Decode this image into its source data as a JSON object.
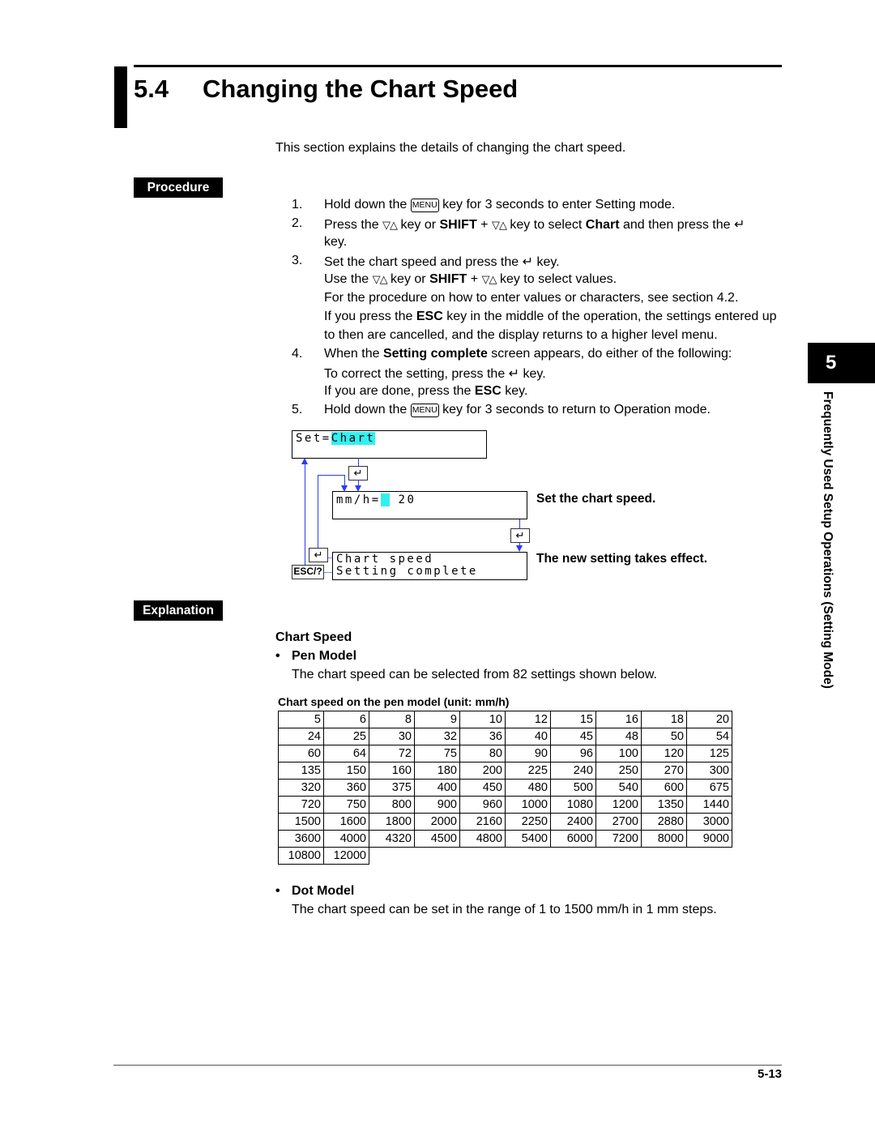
{
  "section": {
    "number": "5.4",
    "title": "Changing the Chart Speed",
    "intro": "This section explains the details of changing the chart speed."
  },
  "procedure_label": "Procedure",
  "explanation_label": "Explanation",
  "keys": {
    "menu": "MENU",
    "updown": "▽△",
    "enter": "↵",
    "esc": "ESC/?"
  },
  "steps": [
    {
      "num": "1.",
      "lines": [
        [
          {
            "t": "Hold down the "
          },
          {
            "k": "menu"
          },
          {
            "t": " key for 3 seconds to enter Setting mode."
          }
        ]
      ]
    },
    {
      "num": "2.",
      "lines": [
        [
          {
            "t": "Press the "
          },
          {
            "k": "updown"
          },
          {
            "t": " key or "
          },
          {
            "t": "SHIFT",
            "b": 1
          },
          {
            "t": " + "
          },
          {
            "k": "updown"
          },
          {
            "t": " key to select "
          },
          {
            "t": "Chart",
            "b": 1
          },
          {
            "t": " and then press the "
          },
          {
            "k": "enter"
          }
        ],
        [
          {
            "t": "key."
          }
        ]
      ]
    },
    {
      "num": "3.",
      "lines": [
        [
          {
            "t": "Set the chart speed and press the "
          },
          {
            "k": "enter"
          },
          {
            "t": " key."
          }
        ],
        [
          {
            "t": "Use the "
          },
          {
            "k": "updown"
          },
          {
            "t": " key or "
          },
          {
            "t": "SHIFT",
            "b": 1
          },
          {
            "t": " + "
          },
          {
            "k": "updown"
          },
          {
            "t": " key to select values."
          }
        ],
        [
          {
            "t": "For the procedure on how to enter values or characters, see section 4.2."
          }
        ],
        [
          {
            "t": "If you press the "
          },
          {
            "t": "ESC",
            "b": 1
          },
          {
            "t": " key in the middle of the operation, the settings entered up"
          }
        ],
        [
          {
            "t": "to then are cancelled, and the display returns to a higher level menu."
          }
        ]
      ]
    },
    {
      "num": "4.",
      "lines": [
        [
          {
            "t": "When the "
          },
          {
            "t": "Setting complete",
            "b": 1
          },
          {
            "t": " screen appears, do either of the following:"
          }
        ],
        [
          {
            "t": "To correct the setting, press the "
          },
          {
            "k": "enter"
          },
          {
            "t": " key."
          }
        ],
        [
          {
            "t": "If you are done, press the "
          },
          {
            "t": "ESC",
            "b": 1
          },
          {
            "t": " key."
          }
        ]
      ]
    },
    {
      "num": "5.",
      "lines": [
        [
          {
            "t": "Hold down the "
          },
          {
            "k": "menu"
          },
          {
            "t": " key for 3 seconds to return to Operation mode."
          }
        ]
      ]
    }
  ],
  "diagram": {
    "screen1": {
      "prefix": "Set=",
      "value": "Chart"
    },
    "screen2": {
      "prefix": "mm/h=",
      "value": "20"
    },
    "screen3": {
      "line1": "Chart speed",
      "line2": "Setting complete"
    },
    "annotation1": "Set the chart speed.",
    "annotation2": "The new setting takes effect.",
    "highlight_color": "#33f0f0",
    "arrow_color": "#2a3cf0"
  },
  "explanation": {
    "heading": "Chart Speed",
    "pen": {
      "title": "Pen Model",
      "text": "The chart speed can be selected from 82 settings shown below."
    },
    "table_caption": "Chart speed on the pen model (unit: mm/h)",
    "table": [
      [
        "5",
        "6",
        "8",
        "9",
        "10",
        "12",
        "15",
        "16",
        "18",
        "20"
      ],
      [
        "24",
        "25",
        "30",
        "32",
        "36",
        "40",
        "45",
        "48",
        "50",
        "54"
      ],
      [
        "60",
        "64",
        "72",
        "75",
        "80",
        "90",
        "96",
        "100",
        "120",
        "125"
      ],
      [
        "135",
        "150",
        "160",
        "180",
        "200",
        "225",
        "240",
        "250",
        "270",
        "300"
      ],
      [
        "320",
        "360",
        "375",
        "400",
        "450",
        "480",
        "500",
        "540",
        "600",
        "675"
      ],
      [
        "720",
        "750",
        "800",
        "900",
        "960",
        "1000",
        "1080",
        "1200",
        "1350",
        "1440"
      ],
      [
        "1500",
        "1600",
        "1800",
        "2000",
        "2160",
        "2250",
        "2400",
        "2700",
        "2880",
        "3000"
      ],
      [
        "3600",
        "4000",
        "4320",
        "4500",
        "4800",
        "5400",
        "6000",
        "7200",
        "8000",
        "9000"
      ],
      [
        "10800",
        "12000"
      ]
    ],
    "dot": {
      "title": "Dot Model",
      "text": "The chart speed can be set in the range of 1 to 1500 mm/h in 1 mm steps."
    },
    "bullet": "•"
  },
  "side_tab": {
    "chapter": "5",
    "title": "Frequently Used Setup Operations (Setting Mode)"
  },
  "page_number": "5-13"
}
